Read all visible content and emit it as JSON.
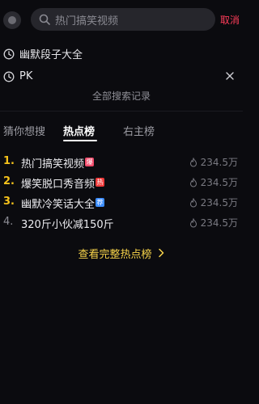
{
  "search": {
    "placeholder": "热门搞笑视频",
    "cancel_label": "取消"
  },
  "history": {
    "items": [
      {
        "text": "幽默段子大全",
        "deletable": false
      },
      {
        "text": "PK",
        "deletable": true
      }
    ],
    "all_label": "全部搜索记录"
  },
  "tabs": [
    {
      "label": "猜你想搜",
      "active": false
    },
    {
      "label": "热点榜",
      "active": true
    },
    {
      "label": "右主榜",
      "active": false
    }
  ],
  "hot_list": [
    {
      "rank": "1.",
      "title": "热门搞笑视频",
      "badge": "爆",
      "badge_color": "#f24a6a",
      "rank_color": "#f5c21b",
      "heat": "234.5万"
    },
    {
      "rank": "2.",
      "title": "爆笑脱口秀音频",
      "badge": "热",
      "badge_color": "#f03a3a",
      "rank_color": "#f5c21b",
      "heat": "234.5万"
    },
    {
      "rank": "3.",
      "title": "幽默冷笑话大全",
      "badge": "荐",
      "badge_color": "#3c8dff",
      "rank_color": "#f5c21b",
      "heat": "234.5万"
    },
    {
      "rank": "4.",
      "title": "320斤小伙减150斤",
      "badge": "",
      "badge_color": "",
      "rank_color": "#8d8d95",
      "heat": "234.5万"
    }
  ],
  "more_label": "查看完整热点榜",
  "colors": {
    "accent_cancel": "#ff3d5a",
    "accent_more": "#f7d34a",
    "background": "#0b0b0f"
  }
}
